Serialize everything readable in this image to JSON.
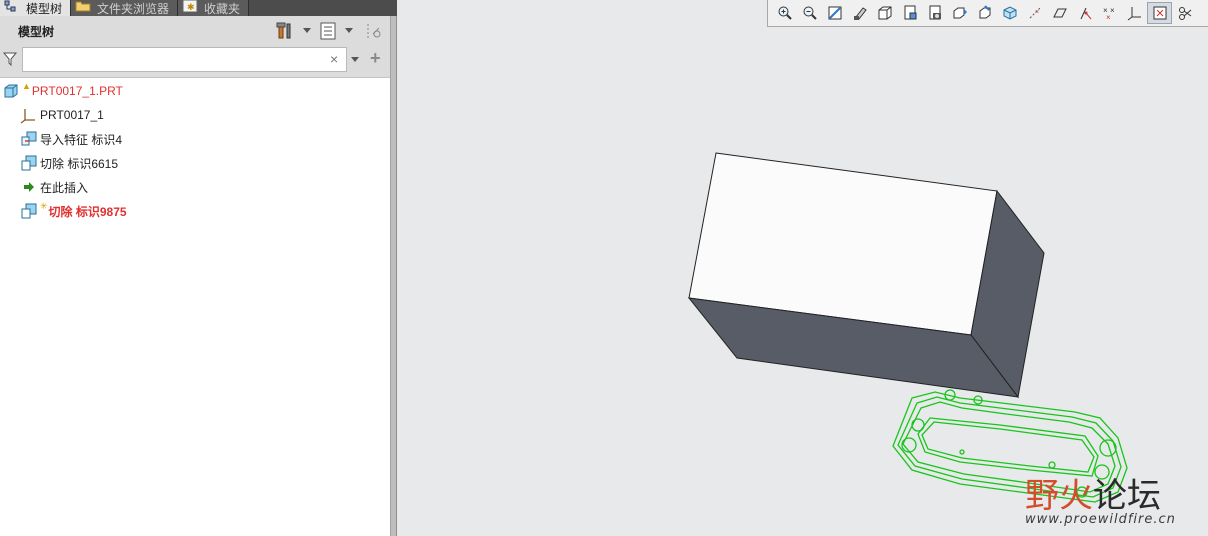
{
  "tabs": [
    {
      "label": "模型树",
      "active": true
    },
    {
      "label": "文件夹浏览器",
      "active": false
    },
    {
      "label": "收藏夹",
      "active": false
    }
  ],
  "tree_header": {
    "title": "模型树"
  },
  "search": {
    "value": "",
    "placeholder": ""
  },
  "tree": [
    {
      "label": "PRT0017_1.PRT",
      "icon": "part-icon",
      "status": "warning",
      "indent": 0
    },
    {
      "label": "PRT0017_1",
      "icon": "csys-icon",
      "indent": 1
    },
    {
      "label": "导入特征 标识4",
      "icon": "import-feature-icon",
      "indent": 1
    },
    {
      "label": "切除 标识6615",
      "icon": "cut-icon",
      "indent": 1
    },
    {
      "label": "在此插入",
      "icon": "insert-here-arrow-icon",
      "indent": 1
    },
    {
      "label": "切除 标识9875",
      "icon": "cut-icon",
      "status": "regen-failed",
      "indent": 1
    }
  ],
  "toolbar": {
    "icons": [
      "zoom-in-icon",
      "zoom-out-icon",
      "refit-icon",
      "repaint-icon",
      "display-style-icon",
      "saved-orientations-icon",
      "named-views-icon",
      "view-manager-icon",
      "perspective-icon",
      "section-icon",
      "datum-axis-icon",
      "datum-plane-icon",
      "datum-point-icon",
      "point-tags-icon",
      "csys-icon",
      "spin-center-icon",
      "annotation-icon"
    ],
    "active_index": 15
  },
  "watermark": {
    "chars_red": "野火",
    "chars_dark": "论坛",
    "url": "www.proewildfire.cn"
  },
  "colors": {
    "accent_error": "#e0312f",
    "mesh_green": "#17c51a",
    "block_top": "#fbfbfb",
    "block_side": "#575c66"
  }
}
